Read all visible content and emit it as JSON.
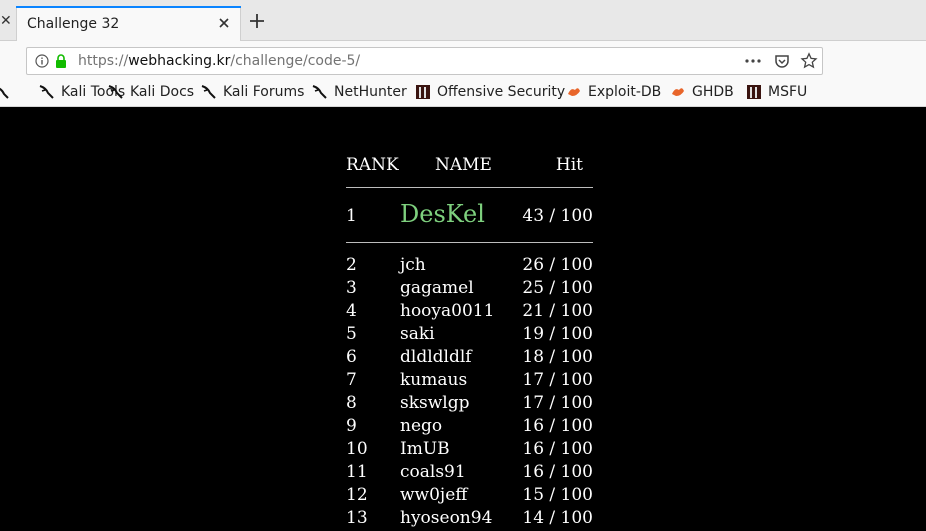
{
  "browser": {
    "tab_title": "Challenge 32",
    "url_prefix": "https://",
    "url_host": "webhacking.kr",
    "url_path": "/challenge/code-5/",
    "bookmarks": [
      {
        "label": "Kali Tools",
        "icon": "kali-dragon-icon"
      },
      {
        "label": "Kali Docs",
        "icon": "kali-dragon-icon"
      },
      {
        "label": "Kali Forums",
        "icon": "kali-dragon-icon"
      },
      {
        "label": "NetHunter",
        "icon": "kali-dragon-icon"
      },
      {
        "label": "Offensive Security",
        "icon": "offsec-icon"
      },
      {
        "label": "Exploit-DB",
        "icon": "exploitdb-icon"
      },
      {
        "label": "GHDB",
        "icon": "exploitdb-icon"
      },
      {
        "label": "MSFU",
        "icon": "offsec-icon"
      }
    ]
  },
  "ranking": {
    "headers": {
      "rank": "RANK",
      "name": "NAME",
      "hit": "Hit"
    },
    "top": {
      "rank": "1",
      "name": "DesKel",
      "hit": "43 / 100"
    },
    "rows": [
      {
        "rank": "2",
        "name": "jch",
        "hit": "26 / 100"
      },
      {
        "rank": "3",
        "name": "gagamel",
        "hit": "25 / 100"
      },
      {
        "rank": "4",
        "name": "hooya0011",
        "hit": "21 / 100"
      },
      {
        "rank": "5",
        "name": "saki",
        "hit": "19 / 100"
      },
      {
        "rank": "6",
        "name": "dldldldlf",
        "hit": "18 / 100"
      },
      {
        "rank": "7",
        "name": "kumaus",
        "hit": "17 / 100"
      },
      {
        "rank": "8",
        "name": "skswlgp",
        "hit": "17 / 100"
      },
      {
        "rank": "9",
        "name": "nego",
        "hit": "16 / 100"
      },
      {
        "rank": "10",
        "name": "ImUB",
        "hit": "16 / 100"
      },
      {
        "rank": "11",
        "name": "coals91",
        "hit": "16 / 100"
      },
      {
        "rank": "12",
        "name": "ww0jeff",
        "hit": "15 / 100"
      },
      {
        "rank": "13",
        "name": "hyoseon94",
        "hit": "14 / 100"
      }
    ]
  },
  "colors": {
    "top_name": "#7ed07e",
    "background": "#000000",
    "text": "#ffffff",
    "tab_accent": "#0a84ff"
  }
}
